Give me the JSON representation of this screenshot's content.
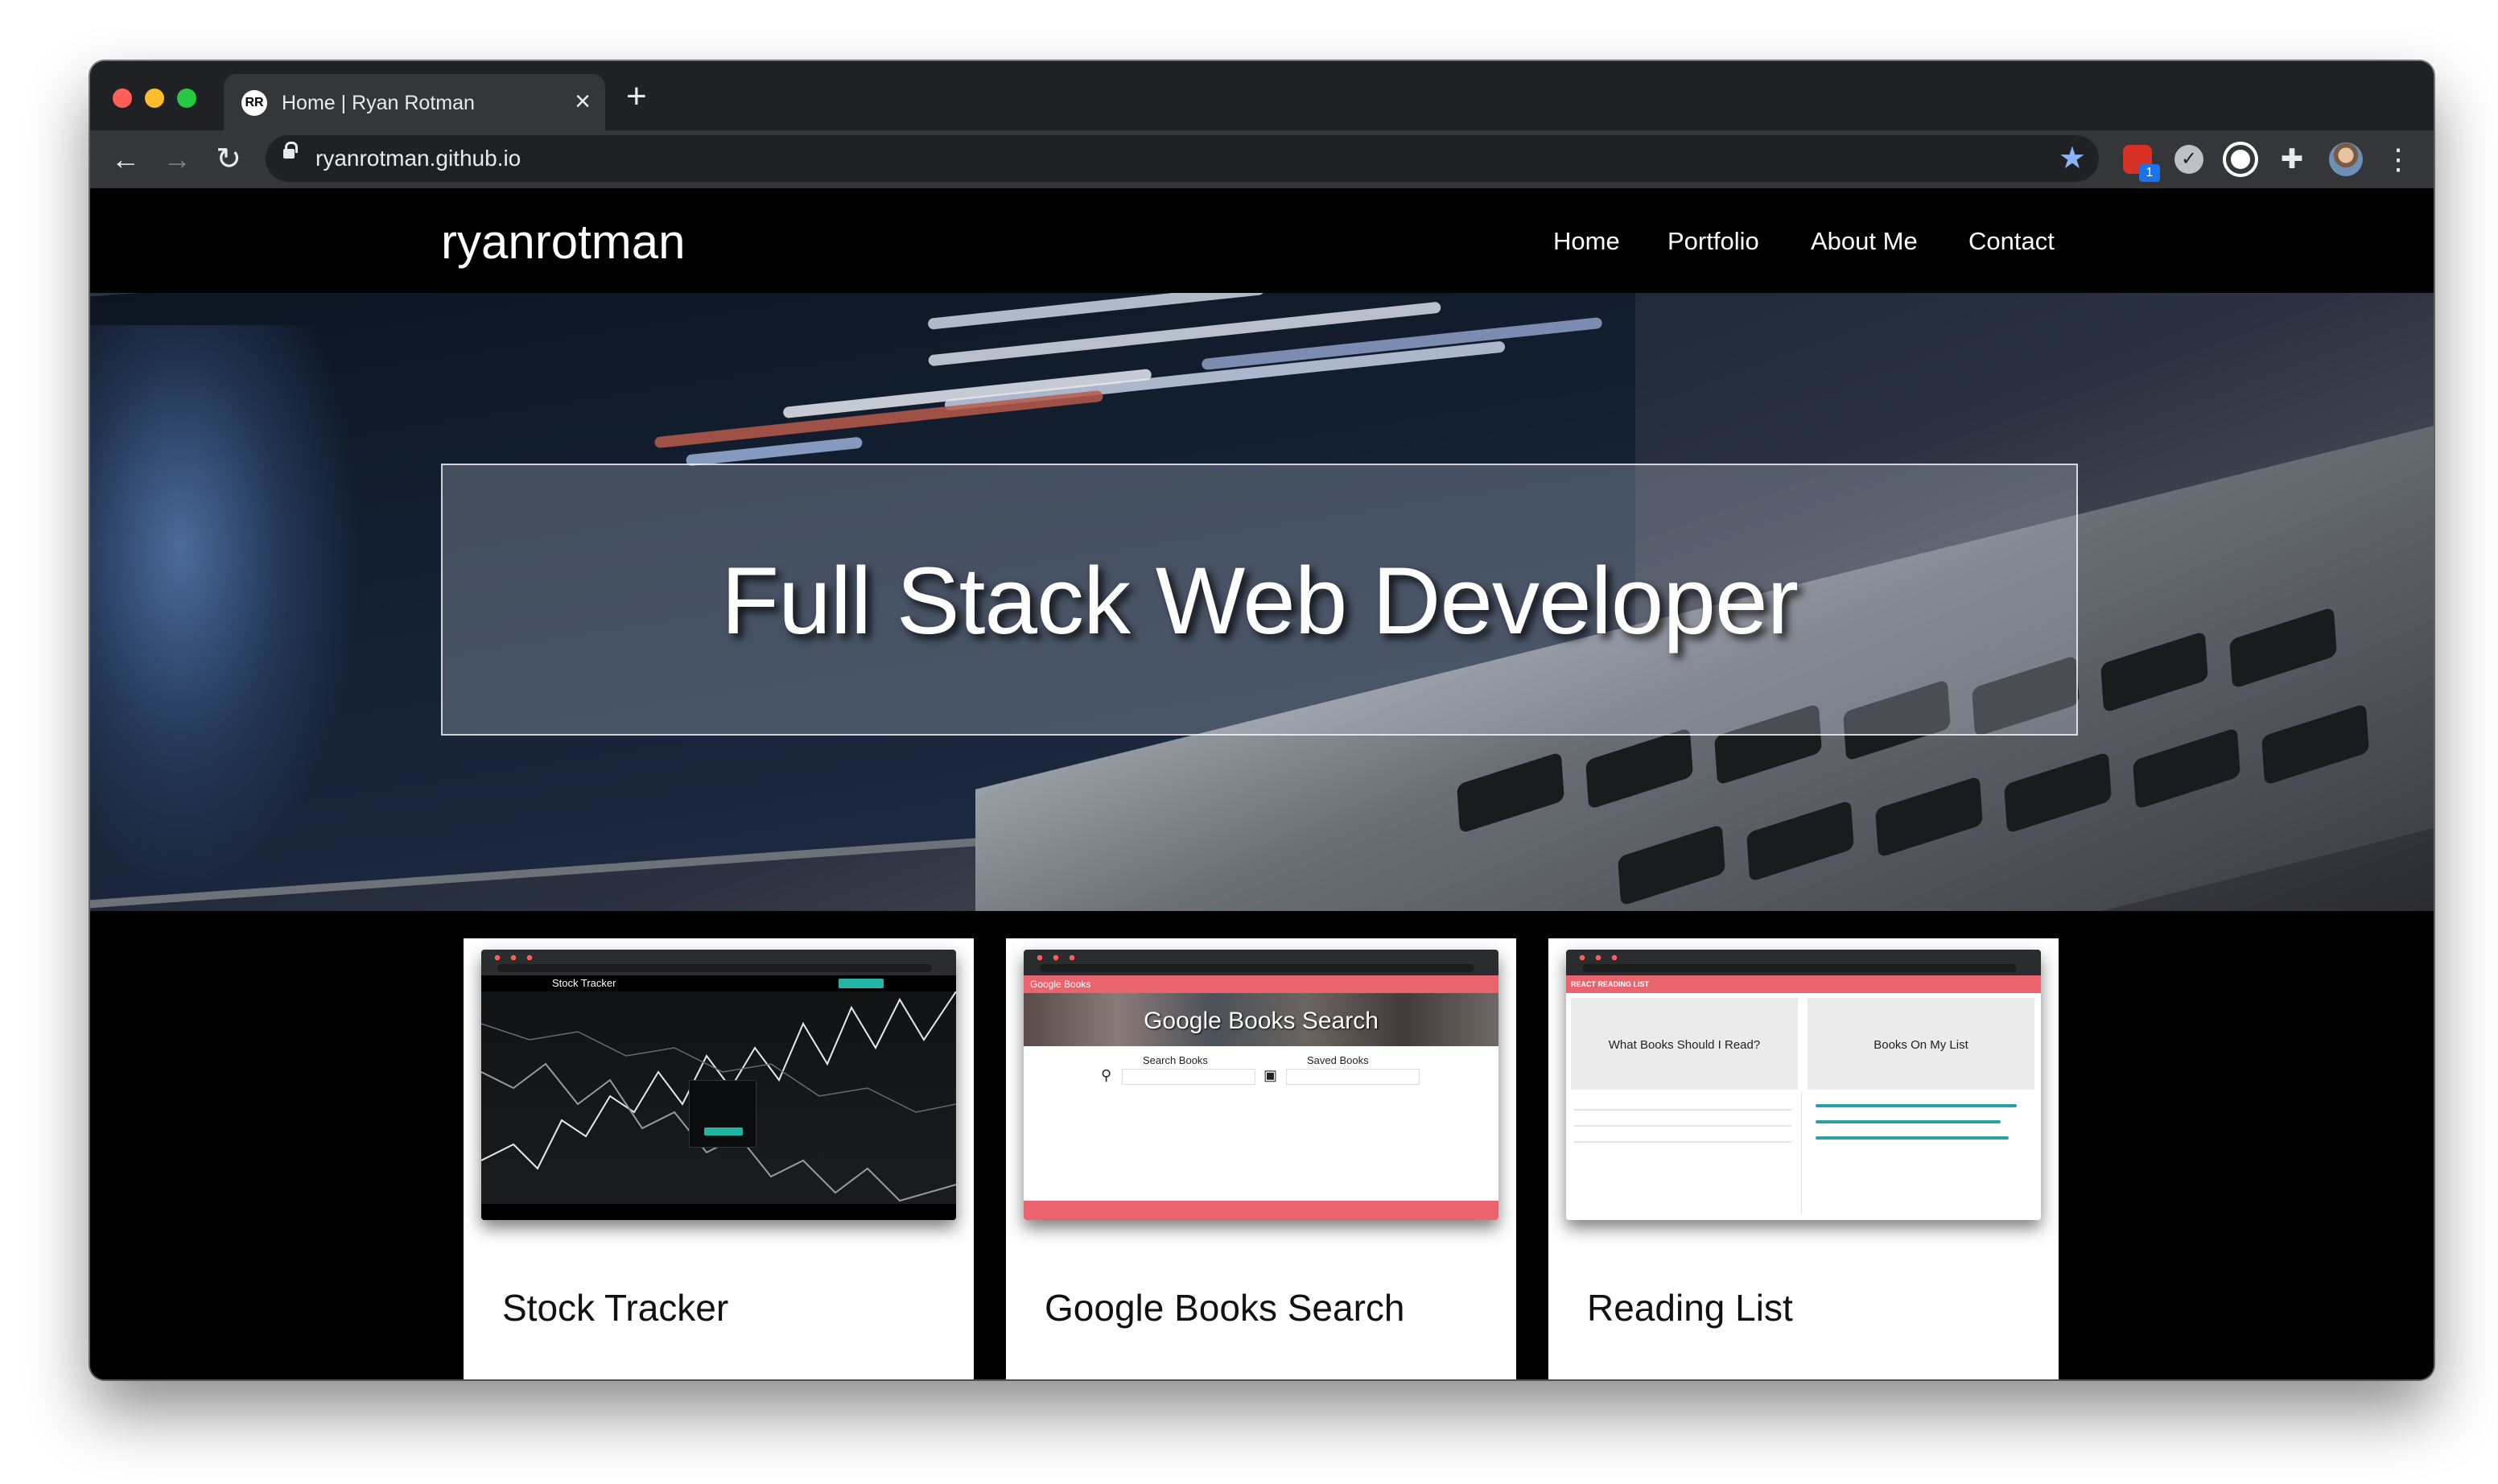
{
  "browser": {
    "tab_title": "Home | Ryan Rotman",
    "tab_favicon_text": "RR",
    "url": "ryanrotman.github.io",
    "extension_badge": "1"
  },
  "site": {
    "brand": "ryanrotman",
    "nav": [
      "Home",
      "Portfolio",
      "About Me",
      "Contact"
    ],
    "hero_title": "Full Stack Web Developer"
  },
  "portfolio": [
    {
      "title": "Stock Tracker",
      "screenshot_header": "Stock Tracker"
    },
    {
      "title": "Google Books Search",
      "screenshot_bar": "Google Books",
      "screenshot_banner": "Google Books Search",
      "screenshot_labels": [
        "Search Books",
        "Saved Books"
      ]
    },
    {
      "title": "Reading List",
      "screenshot_bar": "REACT READING LIST",
      "screenshot_panels": [
        "What Books Should I Read?",
        "Books On My List"
      ]
    }
  ],
  "icons": {
    "back": "arrow-left-icon",
    "forward": "arrow-right-icon",
    "reload": "reload-icon",
    "lock": "lock-icon",
    "star": "bookmark-star-icon",
    "extensions": "puzzle-icon",
    "menu": "vertical-dots-icon"
  },
  "colors": {
    "chrome_dark": "#202124",
    "chrome_toolbar": "#35363a",
    "star_blue": "#8ab4f8",
    "books_accent": "#e9646c",
    "stock_accent": "#22b5a4"
  }
}
